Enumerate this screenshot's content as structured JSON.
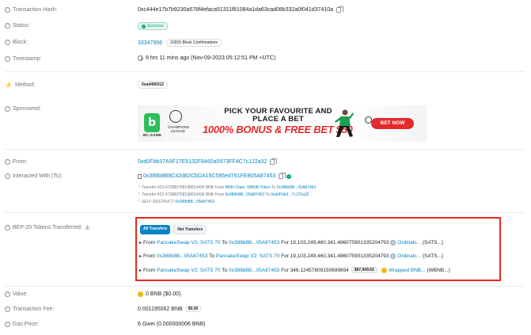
{
  "labels": {
    "tx_hash": "Transaction Hash:",
    "status": "Status:",
    "block": "Block:",
    "timestamp": "Timestamp:",
    "method": "Method:",
    "sponsored": "Sponsored:",
    "from": "From:",
    "interacted_with": "Interacted With (To):",
    "bep20": "BEP-20 Tokens Transferred:",
    "value": "Value:",
    "fee": "Transaction Fee:",
    "gas_price": "Gas Price:"
  },
  "tx_hash": "0xc444e17b7b9230a578f4efaca51311f81084a1da63cad08b332a0f041d37410a",
  "status": "Success",
  "block": {
    "number": "33347956",
    "confirmations": "10915 Block Confirmations"
  },
  "timestamp": "9 hrs 11 mins ago (Nov-09-2023 05:12:51 PM +UTC)",
  "method": "0xad496312",
  "sponsored": {
    "brand": "BC.GAME",
    "league": "CHAMPIONS LEAGUE",
    "headline": "PICK YOUR FAVOURITE AND PLACE A BET",
    "bonus": "1000% BONUS & FREE BET $50",
    "cta": "BET NOW"
  },
  "from_address": "0xd0Fbb37A5F17E5132F8460a5973FF4C7c122a32",
  "to_address": "0x388b8B8C42d82CbDA15C585ed761FE805A87453",
  "internal_transfers": [
    {
      "prefix": "Transfer 423.472889758198610439 BNB From",
      "from": "BNB Chain: WBNB Token",
      "to_label": "To",
      "to": "0x388b8B...05A87453"
    },
    {
      "prefix": "Transfer 423.472889758198610439 BNB From",
      "from": "0x388b8B...05A87453",
      "to_label": "To",
      "to": "0xd0Fbb3...7c122a32"
    },
    {
      "prefix": "SELF DESTRUCT",
      "from": "0x388b8B...05A87453",
      "to_label": "",
      "to": ""
    }
  ],
  "bep20_count": "3",
  "tabs": {
    "all": "All Transfers",
    "net": "Net Transfers"
  },
  "transfers": [
    {
      "from": "PancakeSwap V2: SATS 70",
      "to": "0x388b8B...05A87453",
      "amount": "19,103,249,460,341.486075901335204793",
      "price": "",
      "token": "Ordinals...",
      "token_suffix": "(SATS...)"
    },
    {
      "from": "0x388b8B...05A87453",
      "to": "PancakeSwap V2: SATS 70",
      "amount": "19,103,249,460,341.486075901335204793",
      "price": "",
      "token": "Ordinals...",
      "token_suffix": "(SATS...)"
    },
    {
      "from": "PancakeSwap V2: SATS 70",
      "to": "0x388b8B...05A87453",
      "amount": "346.12457809150699654",
      "price": "$87,949.62",
      "token": "Wrapped BNB...",
      "token_suffix": "(WBNB...)"
    }
  ],
  "words": {
    "from": "From",
    "to": "To",
    "for": "For"
  },
  "value": "0 BNB ($0.00)",
  "fee": {
    "amount": "0.001195062 BNB",
    "usd": "$0.30"
  },
  "gas_price": "6 Gwei (0.000000006 BNB)",
  "colors": {
    "link": "#0784c3",
    "success": "#00a186",
    "highlight_border": "#e8281f",
    "bnb": "#f0b90b"
  }
}
